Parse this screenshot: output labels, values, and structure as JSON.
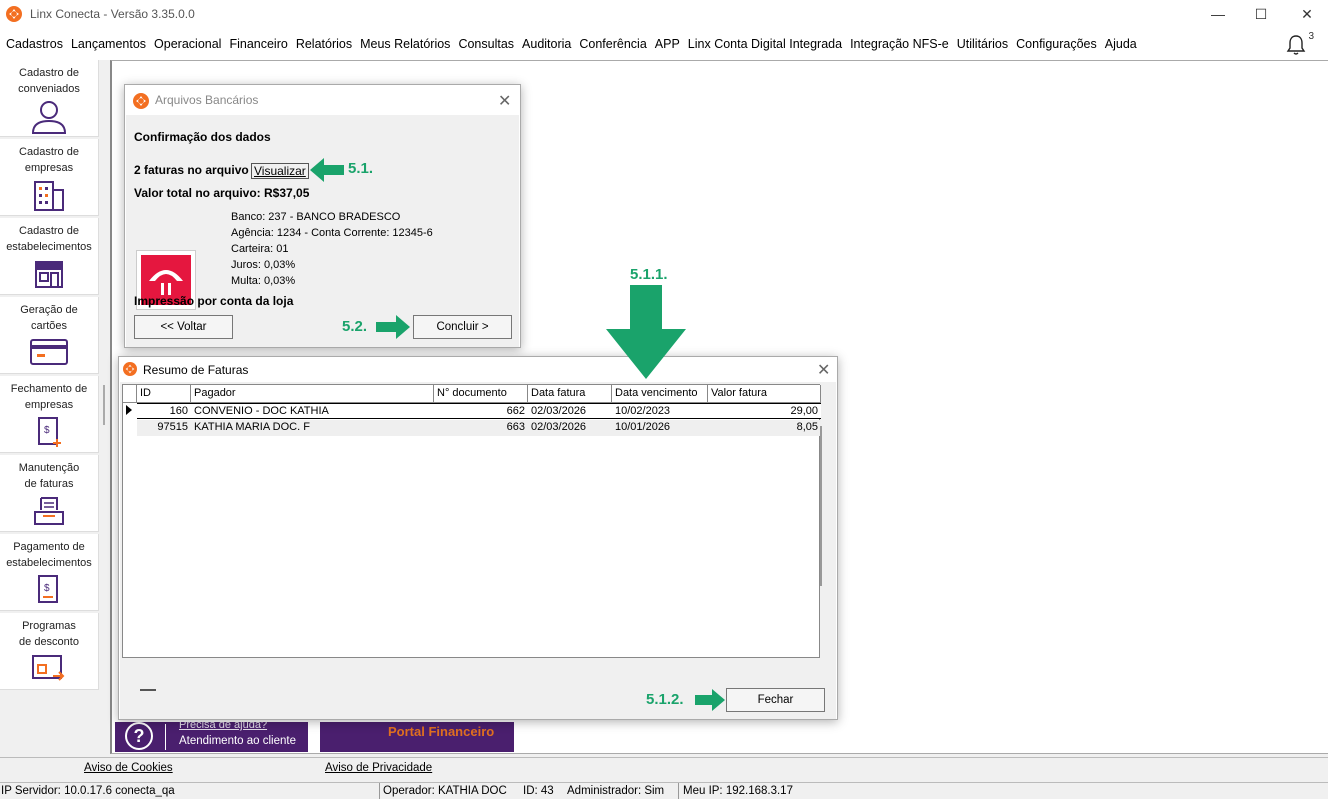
{
  "window": {
    "title": "Linx Conecta - Versão 3.35.0.0",
    "minimize_glyph": "—",
    "maximize_glyph": "☐",
    "close_glyph": "✕"
  },
  "menu": [
    "Cadastros",
    "Lançamentos",
    "Operacional",
    "Financeiro",
    "Relatórios",
    "Meus Relatórios",
    "Consultas",
    "Auditoria",
    "Conferência",
    "APP",
    "Linx Conta Digital Integrada",
    "Integração NFS-e",
    "Utilitários",
    "Configurações",
    "Ajuda"
  ],
  "notifications": {
    "count": "3",
    "icon": "bell-icon"
  },
  "sidebar": [
    {
      "label": "Cadastro de\nconveniados",
      "icon": "user-icon"
    },
    {
      "label": "Cadastro de\nempresas",
      "icon": "building-icon"
    },
    {
      "label": "Cadastro de\nestabelecimentos",
      "icon": "store-icon"
    },
    {
      "label": "Geração de\ncartões",
      "icon": "card-icon"
    },
    {
      "label": "Fechamento de\nempresas",
      "icon": "invoice-icon"
    },
    {
      "label": "Manutenção\nde faturas",
      "icon": "tray-icon"
    },
    {
      "label": "Pagamento de\nestabelecimentos",
      "icon": "payment-icon"
    },
    {
      "label": "Programas\nde desconto",
      "icon": "discount-icon"
    }
  ],
  "banners": {
    "help_line1": "Precisa de ajuda?",
    "help_line2": "Atendimento ao cliente",
    "help_glyph": "?",
    "portal": "Portal Financeiro"
  },
  "footer": {
    "cookies": "Aviso de Cookies",
    "privacy": "Aviso de Privacidade"
  },
  "status": {
    "server": "IP Servidor: 10.0.17.6 conecta_qa",
    "operator": "Operador: KATHIA DOC",
    "id": "ID: 43",
    "admin": "Administrador: Sim",
    "my_ip": "Meu IP: 192.168.3.17"
  },
  "dialog_arquivos": {
    "title": "Arquivos Bancários",
    "close_glyph": "✕",
    "heading": "Confirmação dos dados",
    "faturas_text": "2 faturas no arquivo",
    "visualizar": "Visualizar",
    "valor_total": "Valor total no arquivo: R$37,05",
    "bank_lines": [
      "Banco: 237 - BANCO BRADESCO",
      "Agência: 1234 - Conta Corrente: 12345-6",
      "Carteira: 01",
      "Juros: 0,03%",
      "Multa: 0,03%"
    ],
    "impressao": "Impressão por conta da loja",
    "btn_voltar": "<< Voltar",
    "btn_concluir": "Concluir >"
  },
  "dialog_resumo": {
    "title": "Resumo de Faturas",
    "close_glyph": "✕",
    "columns": [
      "ID",
      "Pagador",
      "N° documento",
      "Data fatura",
      "Data vencimento",
      "Valor fatura"
    ],
    "rows": [
      [
        "160",
        "CONVENIO -  DOC KATHIA",
        "662",
        "02/03/2026",
        "10/02/2023",
        "29,00"
      ],
      [
        "97515",
        "KATHIA MARIA DOC. F",
        "663",
        "02/03/2026",
        "10/01/2026",
        "8,05"
      ]
    ],
    "btn_fechar": "Fechar"
  },
  "annotations": {
    "a1": "5.1.",
    "a2": "5.2.",
    "a3": "5.1.1.",
    "a4": "5.1.2."
  },
  "colors": {
    "accent": "#1aa36b",
    "brand_purple": "#4a1f6e",
    "bradesco_red": "#e5173f",
    "linx_orange": "#f36f21"
  }
}
